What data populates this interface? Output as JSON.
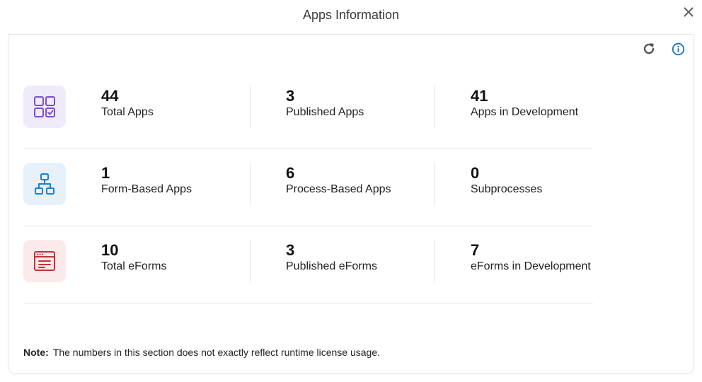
{
  "dialog": {
    "title": "Apps Information"
  },
  "icons": {
    "close": "close-icon",
    "refresh": "refresh-icon",
    "info": "info-icon"
  },
  "rows": [
    {
      "icon": "apps-grid-icon",
      "tile_color": "#efebfb",
      "icon_color": "#7b4fd0",
      "stats": [
        {
          "value": "44",
          "label": "Total Apps"
        },
        {
          "value": "3",
          "label": "Published Apps"
        },
        {
          "value": "41",
          "label": "Apps in Development"
        }
      ]
    },
    {
      "icon": "process-tree-icon",
      "tile_color": "#e6f1fb",
      "icon_color": "#1a7fd4",
      "stats": [
        {
          "value": "1",
          "label": "Form-Based Apps"
        },
        {
          "value": "6",
          "label": "Process-Based Apps"
        },
        {
          "value": "0",
          "label": "Subprocesses"
        }
      ]
    },
    {
      "icon": "eform-window-icon",
      "tile_color": "#fbeaea",
      "icon_color": "#c0343f",
      "stats": [
        {
          "value": "10",
          "label": "Total eForms"
        },
        {
          "value": "3",
          "label": "Published eForms"
        },
        {
          "value": "7",
          "label": "eForms in Development"
        }
      ]
    }
  ],
  "note": {
    "label": "Note:",
    "text": "The numbers in this section does not exactly reflect runtime license usage."
  },
  "colors": {
    "info": "#1a73c8",
    "text": "#1a1a1a",
    "divider": "#e4e4e4"
  }
}
